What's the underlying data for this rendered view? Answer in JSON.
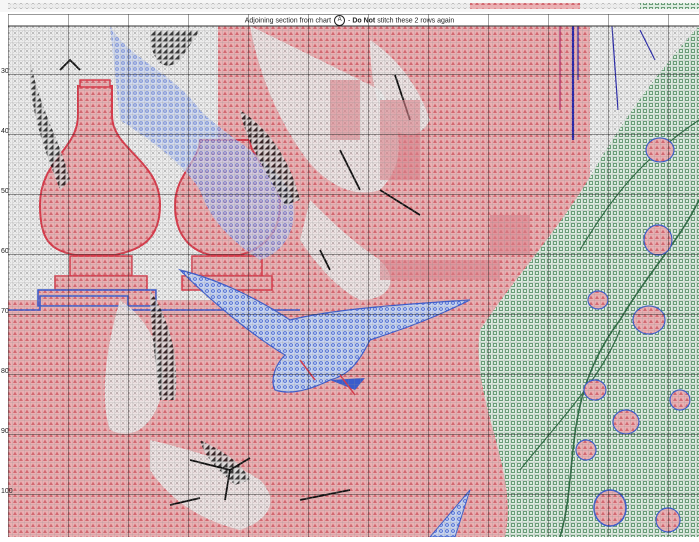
{
  "caption": {
    "prefix": "Adjoining section from chart",
    "section_letter": "A",
    "separator": " - ",
    "emphasis": "Do Not",
    "suffix": " stitch these 2 rows again"
  },
  "row_numbers": [
    "30",
    "40",
    "50",
    "60",
    "70",
    "80",
    "90",
    "100"
  ],
  "colors": {
    "pink_bg": "#e8a4a8",
    "pink_dark": "#c9505a",
    "grey_bg": "#e6e6e6",
    "blue": "#3b5ccc",
    "blue_light": "#9ab3e8",
    "green": "#4d8a5e",
    "green_light": "#c8e2cf",
    "black": "#111111",
    "grid": "#9a9a9a"
  }
}
